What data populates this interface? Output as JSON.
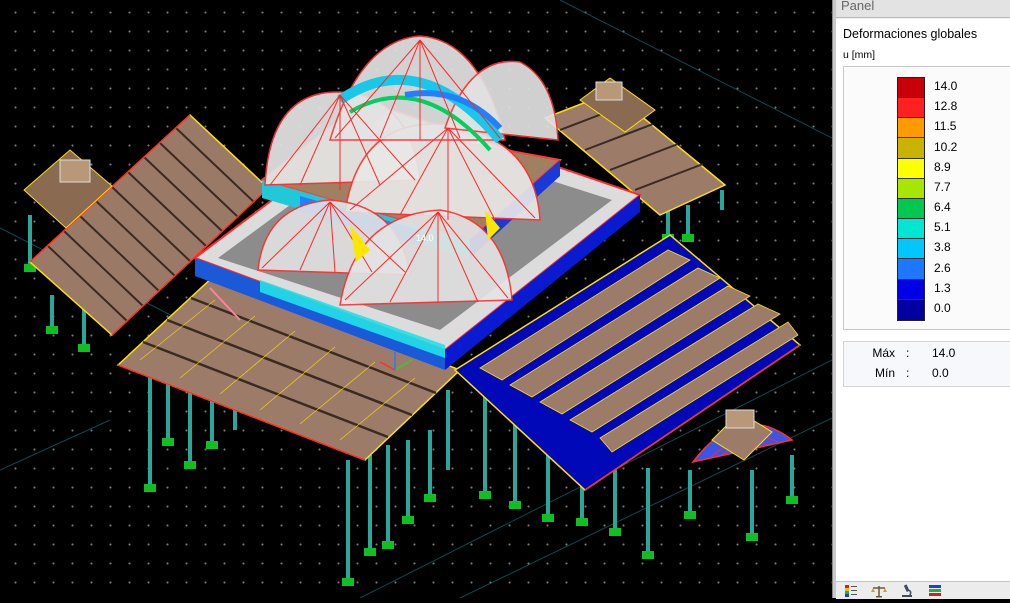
{
  "panel": {
    "title": "Panel",
    "result_title": "Deformaciones globales",
    "unit_label": "u [mm]",
    "legend": [
      {
        "value": "14.0",
        "color": "#c8000a"
      },
      {
        "value": "12.8",
        "color": "#ff2020"
      },
      {
        "value": "11.5",
        "color": "#ff9a00"
      },
      {
        "value": "10.2",
        "color": "#c8b400"
      },
      {
        "value": "8.9",
        "color": "#ffff00"
      },
      {
        "value": "7.7",
        "color": "#a6e600"
      },
      {
        "value": "6.4",
        "color": "#00c850"
      },
      {
        "value": "5.1",
        "color": "#00e6d2"
      },
      {
        "value": "3.8",
        "color": "#00c8ff"
      },
      {
        "value": "2.6",
        "color": "#1e78ff"
      },
      {
        "value": "1.3",
        "color": "#0000e6"
      },
      {
        "value": "0.0",
        "color": "#0000a0"
      }
    ],
    "max": {
      "label": "Máx",
      "colon": ":",
      "value": "14.0"
    },
    "min": {
      "label": "Mín",
      "colon": ":",
      "value": "0.0"
    },
    "toolbar": [
      {
        "icon": "color-scale-icon"
      },
      {
        "icon": "balance-icon"
      },
      {
        "icon": "microscope-icon"
      },
      {
        "icon": "layers-icon"
      }
    ]
  },
  "viewport": {
    "max_marker": "14.0"
  }
}
